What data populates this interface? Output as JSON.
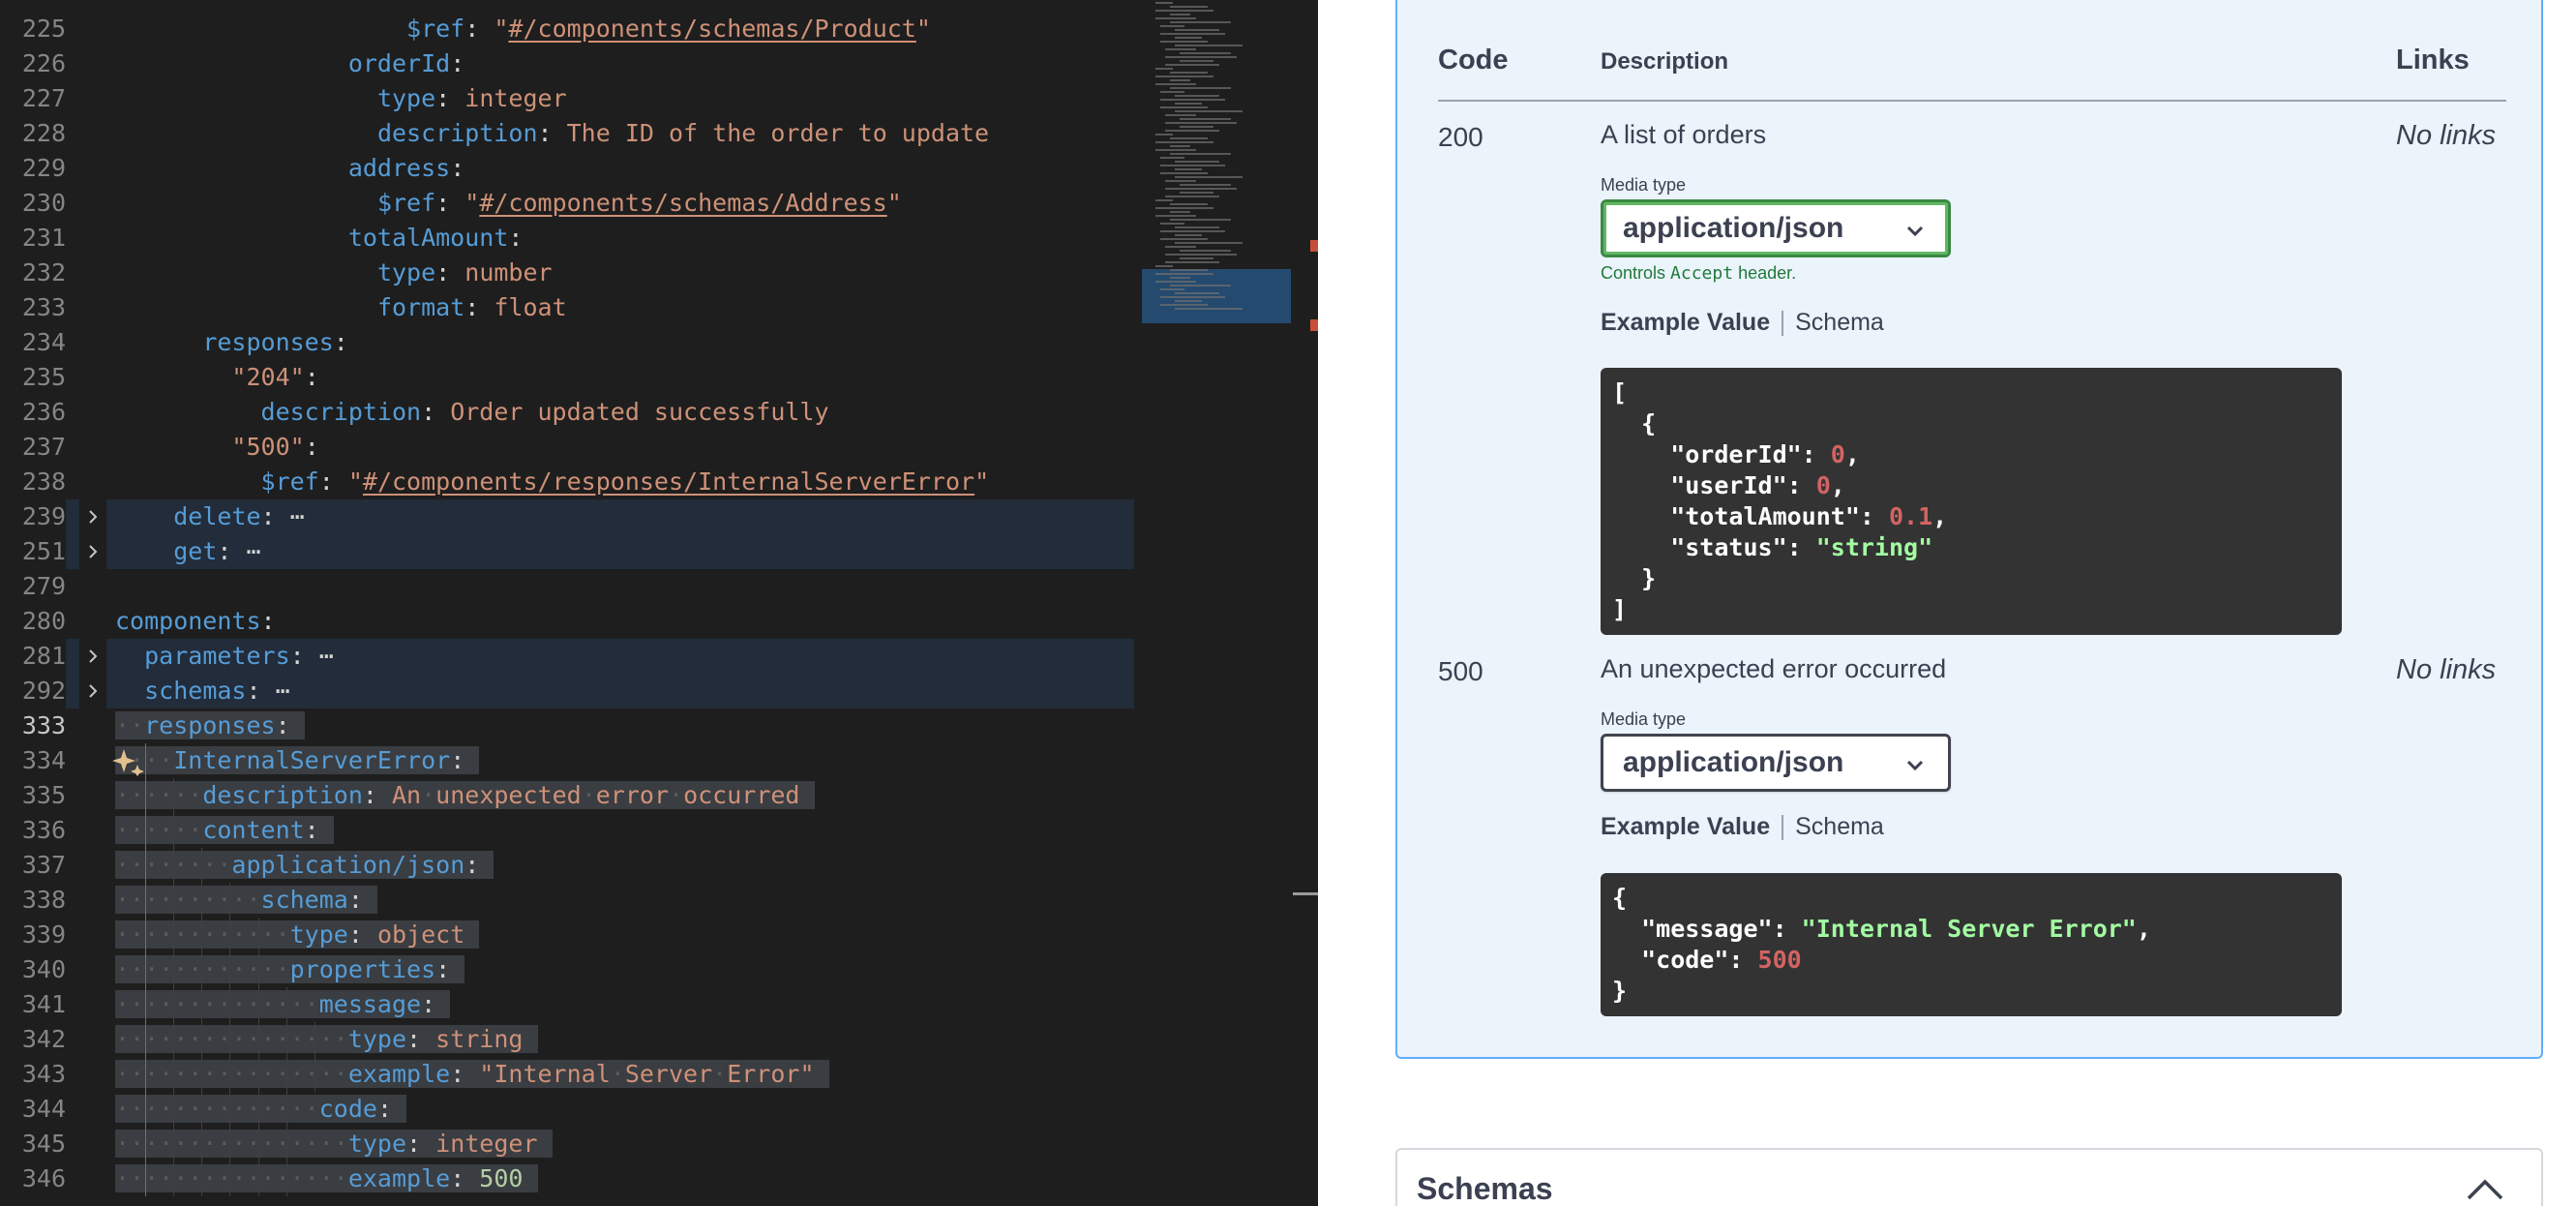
{
  "editor": {
    "lines": [
      {
        "num": "225",
        "indent": 10,
        "tokens": [
          [
            "k",
            "$ref"
          ],
          [
            "p",
            ": "
          ],
          [
            "s",
            "\""
          ],
          [
            "ref",
            "#/components/schemas/Product"
          ],
          [
            "s",
            "\""
          ]
        ]
      },
      {
        "num": "226",
        "indent": 8,
        "tokens": [
          [
            "k",
            "orderId"
          ],
          [
            "p",
            ":"
          ]
        ]
      },
      {
        "num": "227",
        "indent": 9,
        "tokens": [
          [
            "k",
            "type"
          ],
          [
            "p",
            ": "
          ],
          [
            "s",
            "integer"
          ]
        ]
      },
      {
        "num": "228",
        "indent": 9,
        "tokens": [
          [
            "k",
            "description"
          ],
          [
            "p",
            ": "
          ],
          [
            "s",
            "The ID of the order to update"
          ]
        ]
      },
      {
        "num": "229",
        "indent": 8,
        "tokens": [
          [
            "k",
            "address"
          ],
          [
            "p",
            ":"
          ]
        ]
      },
      {
        "num": "230",
        "indent": 9,
        "tokens": [
          [
            "k",
            "$ref"
          ],
          [
            "p",
            ": "
          ],
          [
            "s",
            "\""
          ],
          [
            "ref",
            "#/components/schemas/Address"
          ],
          [
            "s",
            "\""
          ]
        ]
      },
      {
        "num": "231",
        "indent": 8,
        "tokens": [
          [
            "k",
            "totalAmount"
          ],
          [
            "p",
            ":"
          ]
        ]
      },
      {
        "num": "232",
        "indent": 9,
        "tokens": [
          [
            "k",
            "type"
          ],
          [
            "p",
            ": "
          ],
          [
            "s",
            "number"
          ]
        ]
      },
      {
        "num": "233",
        "indent": 9,
        "tokens": [
          [
            "k",
            "format"
          ],
          [
            "p",
            ": "
          ],
          [
            "s",
            "float"
          ]
        ]
      },
      {
        "num": "234",
        "indent": 3,
        "tokens": [
          [
            "k",
            "responses"
          ],
          [
            "p",
            ":"
          ]
        ]
      },
      {
        "num": "235",
        "indent": 4,
        "tokens": [
          [
            "s",
            "\"204\""
          ],
          [
            "p",
            ":"
          ]
        ]
      },
      {
        "num": "236",
        "indent": 5,
        "tokens": [
          [
            "k",
            "description"
          ],
          [
            "p",
            ": "
          ],
          [
            "s",
            "Order updated successfully"
          ]
        ]
      },
      {
        "num": "237",
        "indent": 4,
        "tokens": [
          [
            "s",
            "\"500\""
          ],
          [
            "p",
            ":"
          ]
        ]
      },
      {
        "num": "238",
        "indent": 5,
        "tokens": [
          [
            "k",
            "$ref"
          ],
          [
            "p",
            ": "
          ],
          [
            "s",
            "\""
          ],
          [
            "ref",
            "#/components/responses/InternalServerError"
          ],
          [
            "s",
            "\""
          ]
        ]
      },
      {
        "num": "239",
        "indent": 2,
        "folded": true,
        "tokens": [
          [
            "k",
            "delete"
          ],
          [
            "p",
            ":"
          ],
          [
            "p",
            " ⋯"
          ]
        ]
      },
      {
        "num": "251",
        "indent": 2,
        "folded": true,
        "tokens": [
          [
            "k",
            "get"
          ],
          [
            "p",
            ":"
          ],
          [
            "p",
            " ⋯"
          ]
        ]
      },
      {
        "num": "279",
        "indent": 0,
        "tokens": []
      },
      {
        "num": "280",
        "indent": 0,
        "tokens": [
          [
            "k",
            "components"
          ],
          [
            "p",
            ":"
          ]
        ]
      },
      {
        "num": "281",
        "indent": 1,
        "folded": true,
        "tokens": [
          [
            "k",
            "parameters"
          ],
          [
            "p",
            ":"
          ],
          [
            "p",
            " ⋯"
          ]
        ]
      },
      {
        "num": "292",
        "indent": 1,
        "folded": true,
        "tokens": [
          [
            "k",
            "schemas"
          ],
          [
            "p",
            ":"
          ],
          [
            "p",
            " ⋯"
          ]
        ]
      },
      {
        "num": "333",
        "indent": 1,
        "active": true,
        "selected": true,
        "tokens": [
          [
            "k",
            "responses"
          ],
          [
            "p",
            ":"
          ]
        ]
      },
      {
        "num": "334",
        "indent": 2,
        "selected": true,
        "spark": true,
        "tokens": [
          [
            "k",
            "InternalServerError"
          ],
          [
            "p",
            ":"
          ]
        ]
      },
      {
        "num": "335",
        "indent": 3,
        "selected": true,
        "tokens": [
          [
            "k",
            "description"
          ],
          [
            "p",
            ": "
          ],
          [
            "s",
            "An unexpected error occurred"
          ]
        ]
      },
      {
        "num": "336",
        "indent": 3,
        "selected": true,
        "tokens": [
          [
            "k",
            "content"
          ],
          [
            "p",
            ":"
          ]
        ]
      },
      {
        "num": "337",
        "indent": 4,
        "selected": true,
        "tokens": [
          [
            "k",
            "application/json"
          ],
          [
            "p",
            ":"
          ]
        ]
      },
      {
        "num": "338",
        "indent": 5,
        "selected": true,
        "tokens": [
          [
            "k",
            "schema"
          ],
          [
            "p",
            ":"
          ]
        ]
      },
      {
        "num": "339",
        "indent": 6,
        "selected": true,
        "tokens": [
          [
            "k",
            "type"
          ],
          [
            "p",
            ": "
          ],
          [
            "s",
            "object"
          ]
        ]
      },
      {
        "num": "340",
        "indent": 6,
        "selected": true,
        "tokens": [
          [
            "k",
            "properties"
          ],
          [
            "p",
            ":"
          ]
        ]
      },
      {
        "num": "341",
        "indent": 7,
        "selected": true,
        "tokens": [
          [
            "k",
            "message"
          ],
          [
            "p",
            ":"
          ]
        ]
      },
      {
        "num": "342",
        "indent": 8,
        "selected": true,
        "tokens": [
          [
            "k",
            "type"
          ],
          [
            "p",
            ": "
          ],
          [
            "s",
            "string"
          ]
        ]
      },
      {
        "num": "343",
        "indent": 8,
        "selected": true,
        "tokens": [
          [
            "k",
            "example"
          ],
          [
            "p",
            ": "
          ],
          [
            "s",
            "\"Internal Server Error\""
          ]
        ]
      },
      {
        "num": "344",
        "indent": 7,
        "selected": true,
        "tokens": [
          [
            "k",
            "code"
          ],
          [
            "p",
            ":"
          ]
        ]
      },
      {
        "num": "345",
        "indent": 8,
        "selected": true,
        "tokens": [
          [
            "k",
            "type"
          ],
          [
            "p",
            ": "
          ],
          [
            "s",
            "integer"
          ]
        ]
      },
      {
        "num": "346",
        "indent": 8,
        "selected": true,
        "tokens": [
          [
            "k",
            "example"
          ],
          [
            "p",
            ": "
          ],
          [
            "n",
            "500"
          ]
        ]
      }
    ]
  },
  "swagger": {
    "table_headers": {
      "code": "Code",
      "description": "Description",
      "links": "Links"
    },
    "responses": [
      {
        "code": "200",
        "description": "A list of orders",
        "links": "No links",
        "media_type_label": "Media type",
        "media_type": "application/json",
        "controls_prefix": "Controls",
        "controls_code": "Accept",
        "controls_suffix": "header.",
        "tab_example": "Example Value",
        "tab_schema": "Schema",
        "example_lines": [
          [
            [
              "jk",
              "["
            ]
          ],
          [
            [
              "jk",
              "  {"
            ]
          ],
          [
            [
              "jk",
              "    \"orderId\": "
            ],
            [
              "jn",
              "0"
            ],
            [
              "jk",
              ","
            ]
          ],
          [
            [
              "jk",
              "    \"userId\": "
            ],
            [
              "jn",
              "0"
            ],
            [
              "jk",
              ","
            ]
          ],
          [
            [
              "jk",
              "    \"totalAmount\": "
            ],
            [
              "jn",
              "0.1"
            ],
            [
              "jk",
              ","
            ]
          ],
          [
            [
              "jk",
              "    \"status\": "
            ],
            [
              "js",
              "\"string\""
            ]
          ],
          [
            [
              "jk",
              "  }"
            ]
          ],
          [
            [
              "jk",
              "]"
            ]
          ]
        ]
      },
      {
        "code": "500",
        "description": "An unexpected error occurred",
        "links": "No links",
        "media_type_label": "Media type",
        "media_type": "application/json",
        "tab_example": "Example Value",
        "tab_schema": "Schema",
        "example_lines": [
          [
            [
              "jk",
              "{"
            ]
          ],
          [
            [
              "jk",
              "  \"message\": "
            ],
            [
              "js",
              "\"Internal Server Error\""
            ],
            [
              "jk",
              ","
            ]
          ],
          [
            [
              "jk",
              "  \"code\": "
            ],
            [
              "jn",
              "500"
            ]
          ],
          [
            [
              "jk",
              "}"
            ]
          ]
        ]
      }
    ],
    "schemas_title": "Schemas"
  },
  "colors": {
    "editor_bg": "#1e1e1e",
    "key": "#569cd6",
    "string": "#ce9178",
    "number": "#b5cea8",
    "swagger_accent": "#61affe",
    "json_number": "#d36363",
    "json_string": "#a2fca2"
  }
}
